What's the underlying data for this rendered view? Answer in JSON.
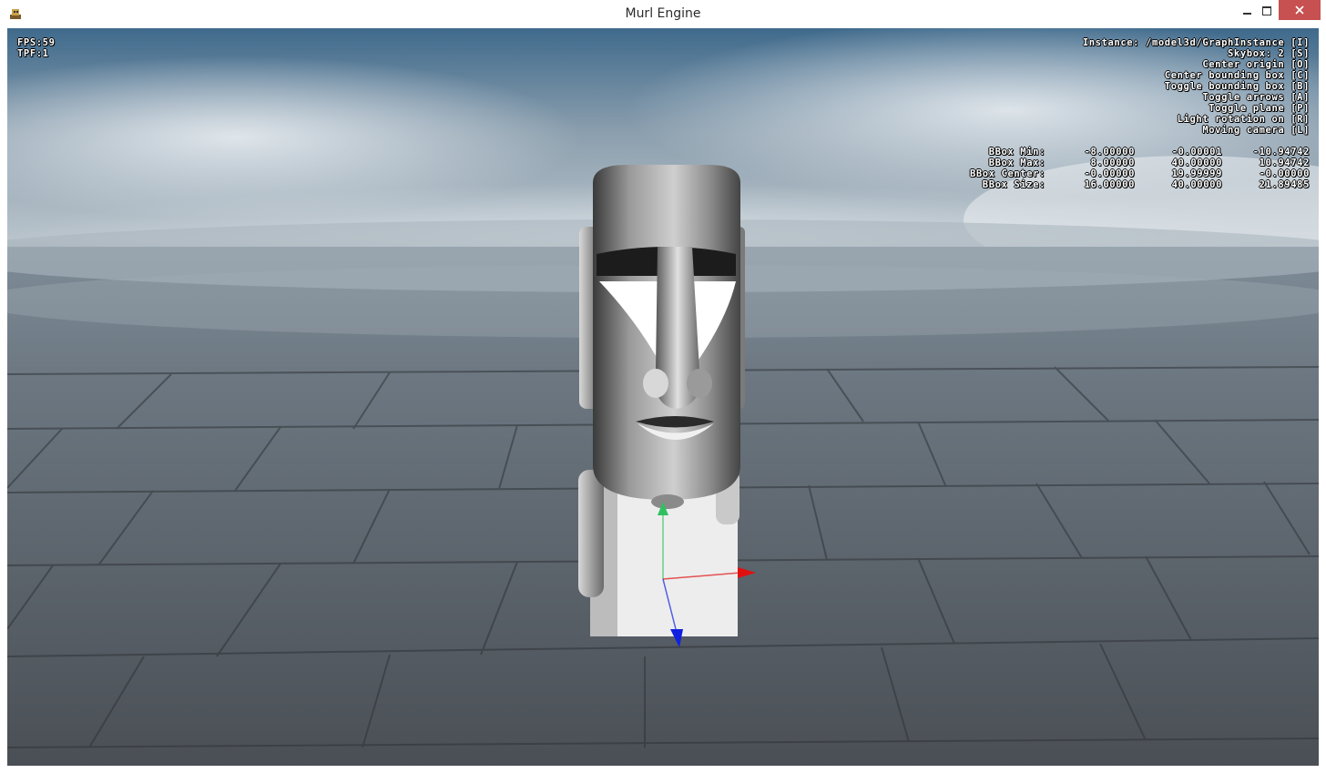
{
  "window": {
    "title": "Murl Engine",
    "icon": "murl-app-icon",
    "controls": [
      "minimize-icon",
      "maximize-icon",
      "close-icon"
    ]
  },
  "hud_stats": {
    "fps": "FPS:59",
    "tpf": "TPF:1"
  },
  "hud_info": {
    "instance": "Instance: /model3d/GraphInstance [I]",
    "skybox": "Skybox: 2 [S]",
    "center_origin": "Center origin [O]",
    "center_bbox": "Center bounding box [C]",
    "toggle_bbox": "Toggle bounding box [B]",
    "toggle_arrows": "Toggle arrows [A]",
    "toggle_plane": "Toggle plane [P]",
    "light_rotation": "Light rotation on [R]",
    "moving_camera": "Moving camera [L]"
  },
  "bbox": [
    {
      "label": "BBox Min:",
      "x": "-8.00000",
      "y": "-0.00001",
      "z": "-10.94742"
    },
    {
      "label": "BBox Max:",
      "x": "8.00000",
      "y": "40.00000",
      "z": "10.94742"
    },
    {
      "label": "BBox Center:",
      "x": "-0.00000",
      "y": "19.99999",
      "z": "-0.00000"
    },
    {
      "label": "BBox Size:",
      "x": "16.00000",
      "y": "40.00000",
      "z": "21.89485"
    }
  ],
  "colors": {
    "close_button": "#c75050",
    "axis_x": "#e01010",
    "axis_y": "#30c060",
    "axis_z": "#1020e0"
  }
}
